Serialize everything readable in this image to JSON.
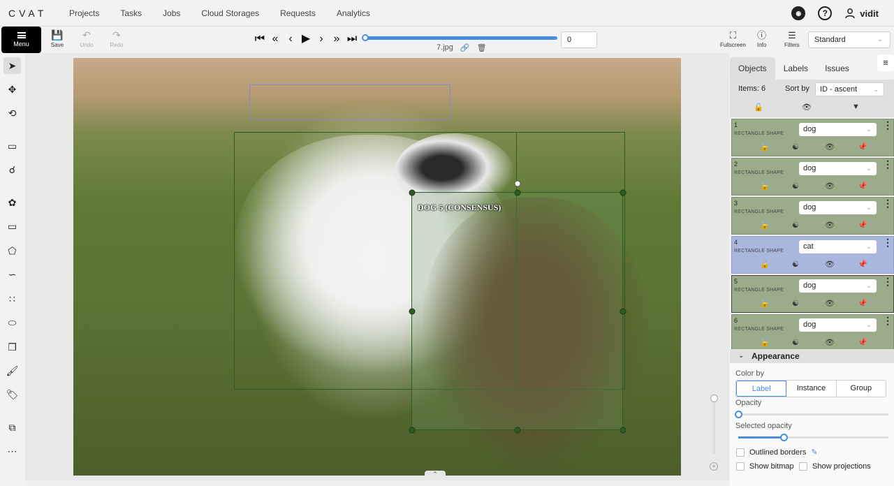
{
  "nav": {
    "logo": "CVAT",
    "links": [
      "Projects",
      "Tasks",
      "Jobs",
      "Cloud Storages",
      "Requests",
      "Analytics"
    ],
    "user": "vidit",
    "github_icon": "github-icon",
    "help_icon": "question-circle-icon",
    "user_icon": "user-icon"
  },
  "toolbar": {
    "menu_label": "Menu",
    "save_label": "Save",
    "undo_label": "Undo",
    "redo_label": "Redo",
    "frame_value": "0",
    "filename": "7.jpg",
    "frame_progress": 0,
    "fullscreen_label": "Fullscreen",
    "info_label": "Info",
    "filters_label": "Filters",
    "workspace_value": "Standard"
  },
  "canvas": {
    "shape_label": "DOG 5 (CONSENSUS)",
    "colors": {
      "dog_box": "#2e5a24",
      "cat_box": "#7f8dc8"
    }
  },
  "sidebar": {
    "tabs": [
      "Objects",
      "Labels",
      "Issues"
    ],
    "items_label": "Items: 6",
    "sort_by_label": "Sort by",
    "sort_value": "ID - ascent",
    "objects": [
      {
        "id": "1",
        "type": "RECTANGLE SHAPE",
        "label": "dog",
        "color": "#9bac8a"
      },
      {
        "id": "2",
        "type": "RECTANGLE SHAPE",
        "label": "dog",
        "color": "#9bac8a"
      },
      {
        "id": "3",
        "type": "RECTANGLE SHAPE",
        "label": "dog",
        "color": "#9bac8a"
      },
      {
        "id": "4",
        "type": "RECTANGLE SHAPE",
        "label": "cat",
        "color": "#a9b7df"
      },
      {
        "id": "5",
        "type": "RECTANGLE SHAPE",
        "label": "dog",
        "color": "#9bac8a"
      },
      {
        "id": "6",
        "type": "RECTANGLE SHAPE",
        "label": "dog",
        "color": "#9bac8a"
      }
    ],
    "appearance": {
      "title": "Appearance",
      "color_by_label": "Color by",
      "color_by_options": [
        "Label",
        "Instance",
        "Group"
      ],
      "color_by_selected": "Label",
      "opacity_label": "Opacity",
      "opacity_value": 0,
      "selected_opacity_label": "Selected opacity",
      "selected_opacity_value": 0.3,
      "outlined_borders_label": "Outlined borders",
      "show_bitmap_label": "Show bitmap",
      "show_projections_label": "Show projections"
    }
  }
}
